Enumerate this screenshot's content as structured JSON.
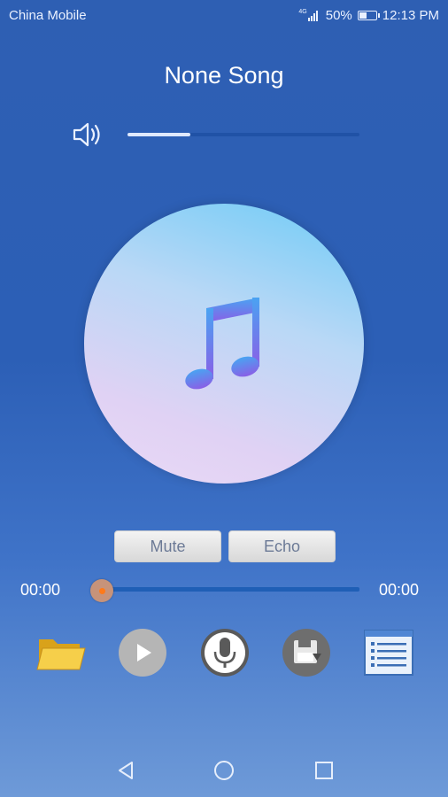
{
  "status_bar": {
    "carrier": "China Mobile",
    "network": "4G",
    "battery": "50%",
    "battery_level": 0.5,
    "time": "12:13 PM"
  },
  "player": {
    "title": "None Song",
    "volume_level": 0.27,
    "mute_label": "Mute",
    "echo_label": "Echo",
    "current_time": "00:00",
    "total_time": "00:00",
    "progress": 0
  },
  "icons": {
    "volume": "volume-icon",
    "disc": "music-note-icon",
    "folder": "folder-icon",
    "play": "play-icon",
    "record": "microphone-icon",
    "save": "save-disk-icon",
    "list": "playlist-icon"
  },
  "colors": {
    "background_top": "#2e5fb3",
    "background_bottom": "#6e9ad8",
    "progress_track": "#1f5fb6",
    "knob_dot": "#ff7a1a"
  }
}
